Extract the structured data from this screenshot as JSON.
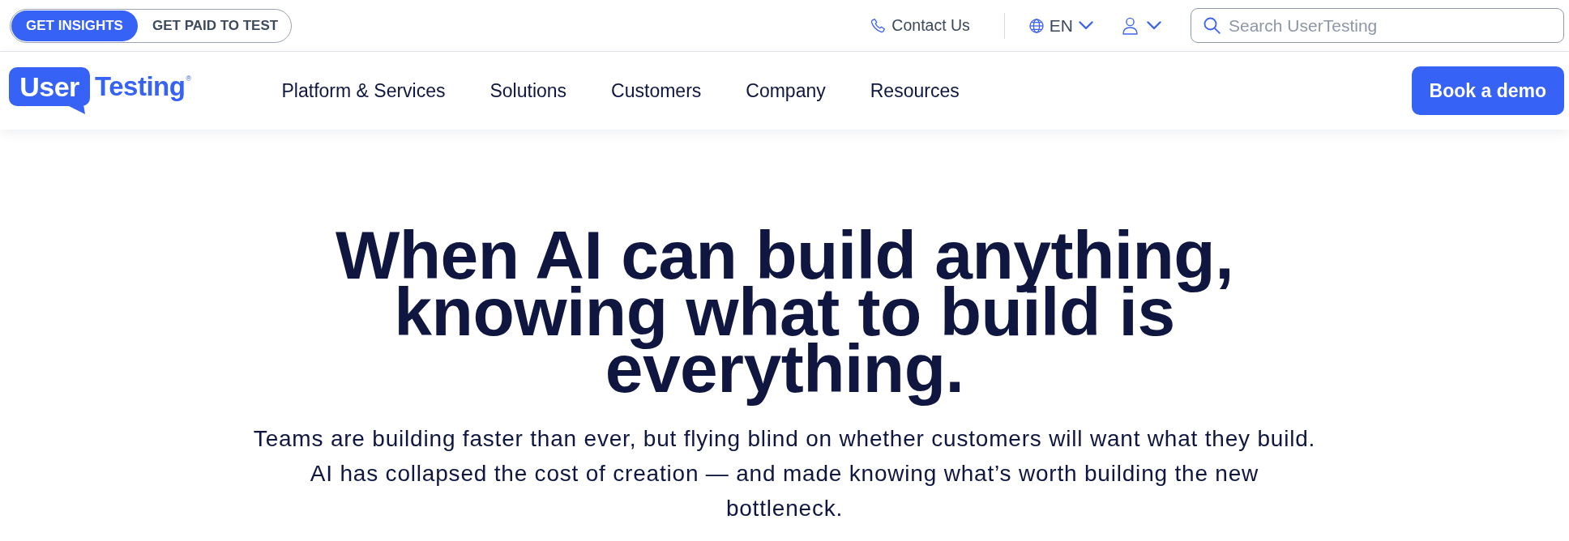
{
  "top_bar": {
    "audience_tabs": [
      {
        "label": "GET INSIGHTS",
        "selected": true
      },
      {
        "label": "GET PAID TO TEST",
        "selected": false
      }
    ],
    "contact_link": "Contact Us",
    "language": "EN",
    "search": {
      "placeholder": "Search UserTesting"
    }
  },
  "header": {
    "logo": {
      "bubble_text": "User",
      "wordmark": "Testing$^{®}$"
    },
    "nav": [
      "Platform & Services",
      "Solutions",
      "Customers",
      "Company",
      "Resources"
    ],
    "cta": "Book a demo"
  },
  "hero": {
    "heading": "When AI can build anything, knowing what to build is everything.",
    "body": "Teams are building faster than ever, but flying blind on whether customers will want what they build. AI has collapsed the cost of creation — and made knowing what’s worth building the new bottleneck."
  }
}
